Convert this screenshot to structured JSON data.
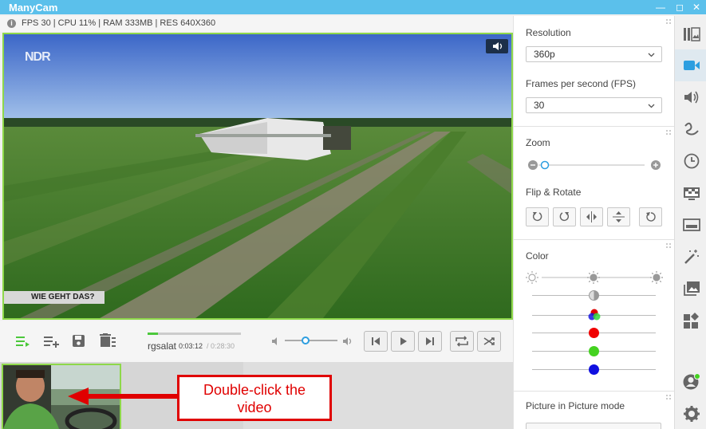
{
  "window": {
    "title": "ManyCam"
  },
  "stats": {
    "text": "FPS 30 | CPU 11% | RAM 333MB | RES 640X360"
  },
  "video": {
    "logo": "NDR",
    "caption": "WIE GEHT DAS?",
    "icons": [
      "volume-icon"
    ]
  },
  "playback": {
    "track_name": "rgsalat",
    "current_time": "0:03:12",
    "total_time": "/ 0:28:30",
    "progress_fraction": 0.11,
    "volume_fraction": 0.4
  },
  "callout": {
    "line1": "Double-click the",
    "line2": "video"
  },
  "panel": {
    "resolution_label": "Resolution",
    "resolution_value": "360p",
    "fps_label": "Frames per second (FPS)",
    "fps_value": "30",
    "zoom_label": "Zoom",
    "flip_label": "Flip & Rotate",
    "color_label": "Color",
    "pip_label": "Picture in Picture mode"
  },
  "rail": [
    "presets-icon",
    "video-icon",
    "audio-icon",
    "draw-icon",
    "clock-icon",
    "chroma-key-icon",
    "lower-third-icon",
    "effects-icon",
    "image-icon",
    "widgets-icon",
    "account-icon",
    "settings-icon"
  ],
  "colors": {
    "accent": "#5bc0eb",
    "active_green": "#4cc83c",
    "callout_red": "#e00000"
  }
}
